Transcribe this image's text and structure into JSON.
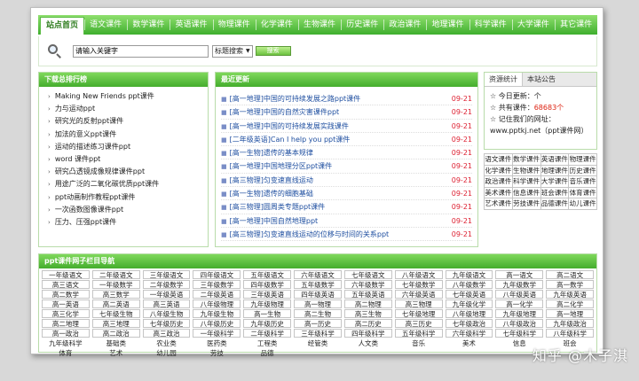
{
  "nav": {
    "items": [
      "站点首页",
      "语文课件",
      "数学课件",
      "英语课件",
      "物理课件",
      "化学课件",
      "生物课件",
      "历史课件",
      "政治课件",
      "地理课件",
      "科学课件",
      "大学课件",
      "其它课件"
    ]
  },
  "search": {
    "value": "请输入关键字",
    "select_value": "标题搜索",
    "button_label": "搜索"
  },
  "hot": {
    "title": "下载总排行榜",
    "items": [
      "Making New Friends ppt课件",
      "力与运动ppt",
      "研究光的反射ppt课件",
      "加法的意义ppt课件",
      "运动的描述练习课件ppt",
      "word 课件ppt",
      "研究凸透镜成像规律课件ppt",
      "用途广泛的二氧化碳优质ppt课件",
      "ppt动画制作教程ppt课件",
      "一次函数图像课件ppt",
      "压力、压强ppt课件"
    ]
  },
  "news": {
    "title": "最近更新",
    "items": [
      {
        "title": "[高一地理]中国的可持续发展之路ppt课件",
        "date": "09-21"
      },
      {
        "title": "[高一地理]中国的自然灾害课件ppt",
        "date": "09-21"
      },
      {
        "title": "[高一地理]中国的可持续发展实践课件",
        "date": "09-21"
      },
      {
        "title": "[二年级英语]Can I help you ppt课件",
        "date": "09-21"
      },
      {
        "title": "[高一生物]遗传的基本规律",
        "date": "09-21"
      },
      {
        "title": "[高一地理]中国地理分区ppt课件",
        "date": "09-21"
      },
      {
        "title": "[高三物理]匀变速直线运动",
        "date": "09-21"
      },
      {
        "title": "[高一生物]遗传的细胞基础",
        "date": "09-21"
      },
      {
        "title": "[高三物理]圆周类专题ppt课件",
        "date": "09-21"
      },
      {
        "title": "[高一地理]中国自然地理ppt",
        "date": "09-21"
      },
      {
        "title": "[高三物理]匀变速直线运动的位移与时间的关系ppt",
        "date": "09-21"
      }
    ]
  },
  "stats": {
    "tabs": [
      "资源统计",
      "本站公告"
    ],
    "today_label": "今日更新：",
    "today_value": "个",
    "total_label": "共有课件：",
    "total_value": "68683个",
    "remember_text": "记住我们的网址：www.pptkj.net（ppt课件网）"
  },
  "subjects": [
    "语文课件",
    "数学课件",
    "英语课件",
    "物理课件",
    "化学课件",
    "生物课件",
    "地理课件",
    "历史课件",
    "政治课件",
    "科学课件",
    "大学课件",
    "音乐课件",
    "美术课件",
    "信息课件",
    "班会课件",
    "体育课件",
    "艺术课件",
    "劳技课件",
    "品德课件",
    "幼儿课件"
  ],
  "bottom": {
    "title": "ppt课件网子栏目导航",
    "cells": [
      "一年级语文",
      "二年级语文",
      "三年级语文",
      "四年级语文",
      "五年级语文",
      "六年级语文",
      "七年级语文",
      "八年级语文",
      "九年级语文",
      "高一语文",
      "高二语文",
      "高三语文",
      "一年级数学",
      "二年级数学",
      "三年级数学",
      "四年级数学",
      "五年级数学",
      "六年级数学",
      "七年级数学",
      "八年级数学",
      "九年级数学",
      "高一数学",
      "高二数学",
      "高三数学",
      "一年级英语",
      "二年级英语",
      "三年级英语",
      "四年级英语",
      "五年级英语",
      "六年级英语",
      "七年级英语",
      "八年级英语",
      "九年级英语",
      "高一英语",
      "高二英语",
      "高三英语",
      "八年级物理",
      "九年级物理",
      "高一物理",
      "高二物理",
      "高三物理",
      "九年级化学",
      "高一化学",
      "高二化学",
      "高三化学",
      "七年级生物",
      "八年级生物",
      "九年级生物",
      "高一生物",
      "高二生物",
      "高三生物",
      "七年级地理",
      "八年级地理",
      "九年级地理",
      "高一地理",
      "高二地理",
      "高三地理",
      "七年级历史",
      "八年级历史",
      "九年级历史",
      "高一历史",
      "高二历史",
      "高三历史",
      "七年级政治",
      "八年级政治",
      "九年级政治",
      "高一政治",
      "高二政治",
      "高三政治",
      "一年级科学",
      "二年级科学",
      "三年级科学",
      "四年级科学",
      "五年级科学",
      "六年级科学",
      "七年级科学",
      "八年级科学",
      "九年级科学",
      "基础类",
      "农业类",
      "医药类",
      "工程类",
      "经管类",
      "人文类",
      "音乐",
      "美术",
      "信息",
      "班会",
      "体育",
      "艺术",
      "幼儿园",
      "劳技",
      "品德"
    ]
  },
  "watermark": "知乎 @木子淇"
}
